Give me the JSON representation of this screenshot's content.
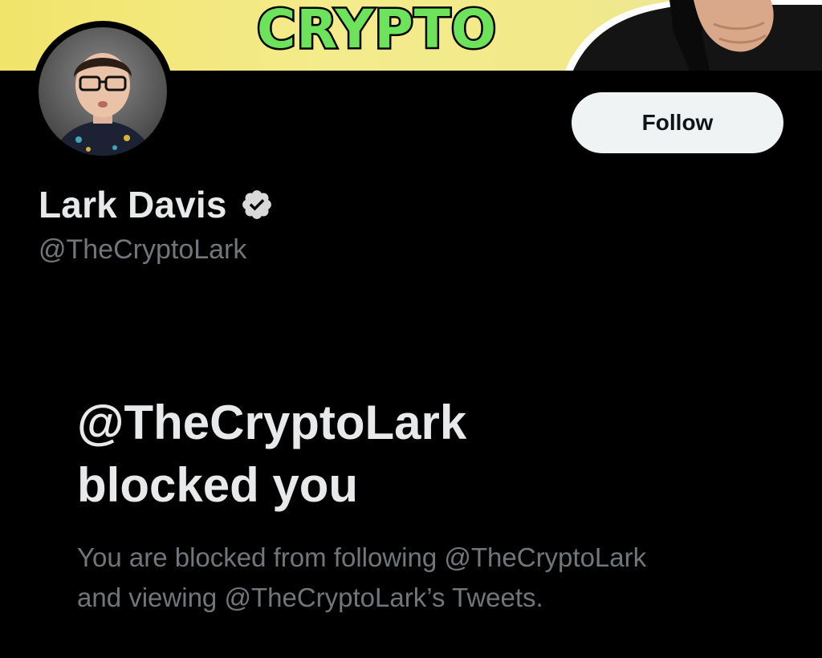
{
  "banner": {
    "word": "CRYPTO",
    "word_color": "#6ce35a",
    "background_color": "#f1e46a"
  },
  "profile": {
    "display_name": "Lark Davis",
    "verified_icon": "verified-badge-icon",
    "handle": "@TheCryptoLark",
    "follow_label": "Follow"
  },
  "blocked": {
    "title_line1": "@TheCryptoLark",
    "title_line2": "blocked you",
    "body_line1": "You are blocked from following @TheCryptoLark",
    "body_line2": "and viewing @TheCryptoLark’s Tweets."
  },
  "colors": {
    "background": "#000000",
    "primary_text": "#e7e9ea",
    "secondary_text": "#71767b",
    "button_bg": "#eff3f4",
    "button_text": "#0f1419"
  }
}
